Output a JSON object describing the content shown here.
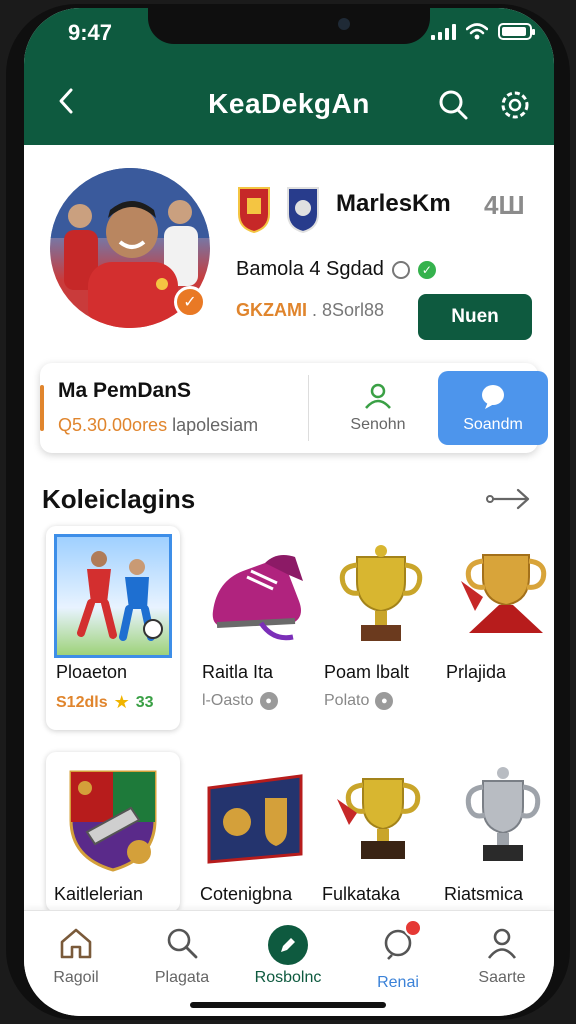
{
  "status_bar": {
    "time": "9:47"
  },
  "header": {
    "title": "KeaDekgAn"
  },
  "profile": {
    "name": "MarlesKm",
    "number": "4Ш",
    "team_line": "Bamola 4 Sgdad",
    "stats_highlight": "GKZAMI",
    "stats_rest": ". 8Sorl88",
    "follow_label": "Nuen"
  },
  "info_card": {
    "title": "Ma PemDanS",
    "sub_highlight": "Q5.30.00ores",
    "sub_rest": "lapolesiam",
    "option1_label": "Senohn",
    "option2_label": "Soandm"
  },
  "collections": {
    "title": "Koleiclagins",
    "row1": [
      {
        "title": "Ploaeton",
        "sub_orange": "S12dls",
        "sub_green": "33"
      },
      {
        "title": "Raitla Ita",
        "sub": "l-Oasto"
      },
      {
        "title": "Poam lbalt",
        "sub": "Polato"
      },
      {
        "title": "Prlajida"
      }
    ],
    "row2": [
      {
        "title": "Kaitlelerian"
      },
      {
        "title": "Cotenigbna"
      },
      {
        "title": "Fulkataka"
      },
      {
        "title": "Riatsmica"
      }
    ]
  },
  "bottom_nav": [
    {
      "label": "Ragoil",
      "icon": "home-icon"
    },
    {
      "label": "Plagata",
      "icon": "search-icon"
    },
    {
      "label": "Rosbolnc",
      "icon": "compose-icon"
    },
    {
      "label": "Renai",
      "icon": "notification-icon"
    },
    {
      "label": "Saarte",
      "icon": "profile-icon"
    }
  ],
  "colors": {
    "primary": "#0e5a3f",
    "accent": "#e0852d",
    "blue": "#4d95ec"
  }
}
